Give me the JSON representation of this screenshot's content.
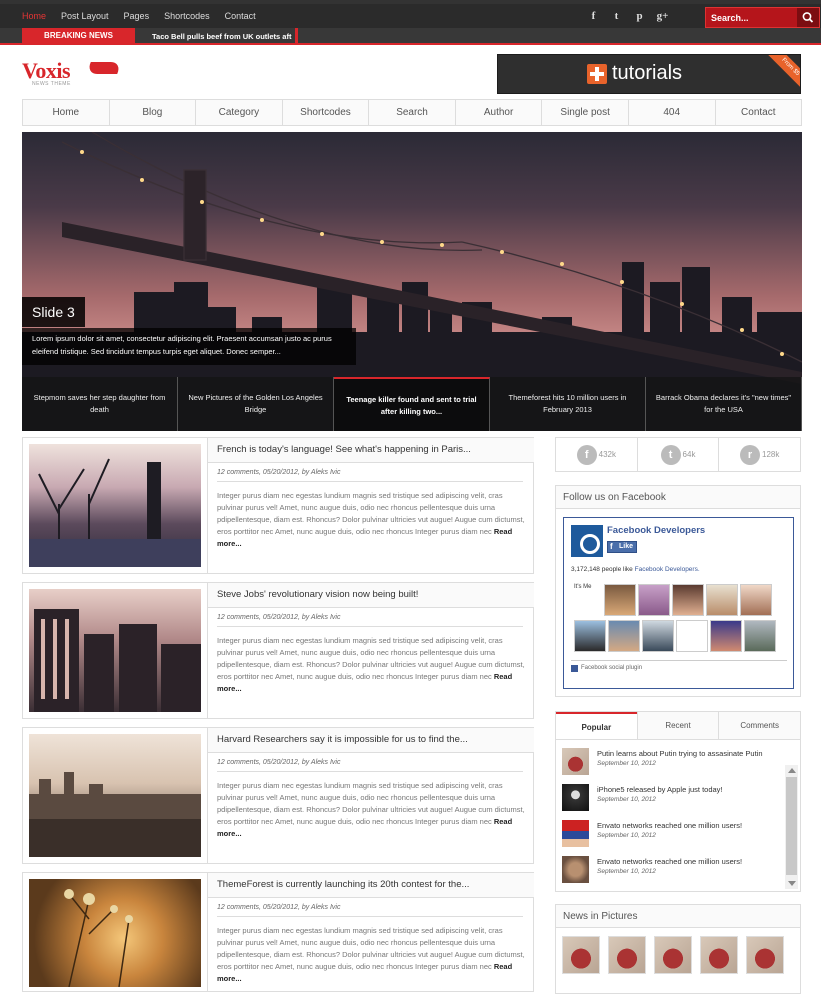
{
  "topnav": {
    "items": [
      "Home",
      "Post Layout",
      "Pages",
      "Shortcodes",
      "Contact"
    ],
    "active": "Home"
  },
  "social": {
    "icons": [
      "facebook-icon",
      "twitter-icon",
      "pinterest-icon",
      "google-plus-icon"
    ],
    "glyphs": [
      "f",
      "t",
      "p",
      "g+"
    ]
  },
  "search": {
    "placeholder": "Search..."
  },
  "breaking": {
    "label": "BREAKING NEWS",
    "headline": "Taco Bell pulls beef from UK outlets aft"
  },
  "logo": {
    "name": "Voxis",
    "tagline": "NEWS THEME"
  },
  "ad": {
    "text": "tutorials",
    "ribbon": "From $5"
  },
  "mainnav": [
    "Home",
    "Blog",
    "Category",
    "Shortcodes",
    "Search",
    "Author",
    "Single post",
    "404",
    "Contact"
  ],
  "slider": {
    "title": "Slide 3",
    "description": "Lorem ipsum dolor sit amet, consectetur adipiscing elit. Praesent accumsan justo ac purus eleifend tristique. Sed tincidunt tempus turpis eget aliquet. Donec semper...",
    "thumbs": [
      "Stepmom saves her step daughter from death",
      "New Pictures of the Golden Los Angeles Bridge",
      "Teenage killer found and sent to trial after killing two...",
      "Themeforest hits 10 million users in February 2013",
      "Barrack Obama declares it's \"new times\" for the USA"
    ],
    "active_thumb": 2
  },
  "posts": [
    {
      "title": "French is today's language! See what's happening in Paris...",
      "meta": "12 comments, 05/20/2012, by Aleks Ivic",
      "excerpt": "Integer purus diam nec egestas lundium magnis sed tristique sed adipiscing velit, cras pulvinar purus vel! Amet, nunc augue duis, odio nec rhoncus pellentesque duis urna pdipellentesque, diam est. Rhoncus? Dolor pulvinar ultricies vut augue! Augue cum dictumst, eros porttitor nec Amet, nunc augue duis, odio nec rhoncus Integer purus diam nec",
      "more": "Read more..."
    },
    {
      "title": "Steve Jobs' revolutionary vision now being built!",
      "meta": "12 comments, 05/20/2012, by Aleks Ivic",
      "excerpt": "Integer purus diam nec egestas lundium magnis sed tristique sed adipiscing velit, cras pulvinar purus vel! Amet, nunc augue duis, odio nec rhoncus pellentesque duis urna pdipellentesque, diam est. Rhoncus? Dolor pulvinar ultricies vut augue! Augue cum dictumst, eros porttitor nec Amet, nunc augue duis, odio nec rhoncus Integer purus diam nec",
      "more": "Read more..."
    },
    {
      "title": "Harvard Researchers say it is impossible for us to find the...",
      "meta": "12 comments, 05/20/2012, by Aleks Ivic",
      "excerpt": "Integer purus diam nec egestas lundium magnis sed tristique sed adipiscing velit, cras pulvinar purus vel! Amet, nunc augue duis, odio nec rhoncus pellentesque duis urna pdipellentesque, diam est. Rhoncus? Dolor pulvinar ultricies vut augue! Augue cum dictumst, eros porttitor nec Amet, nunc augue duis, odio nec rhoncus Integer purus diam nec",
      "more": "Read more..."
    },
    {
      "title": "ThemeForest is currently launching its 20th contest for the...",
      "meta": "12 comments, 05/20/2012, by Aleks Ivic",
      "excerpt": "Integer purus diam nec egestas lundium magnis sed tristique sed adipiscing velit, cras pulvinar purus vel! Amet, nunc augue duis, odio nec rhoncus pellentesque duis urna pdipellentesque, diam est. Rhoncus? Dolor pulvinar ultricies vut augue! Augue cum dictumst, eros porttitor nec Amet, nunc augue duis, odio nec rhoncus Integer purus diam nec",
      "more": "Read more..."
    }
  ],
  "counts": [
    {
      "icon": "facebook-icon",
      "glyph": "f",
      "value": "432k"
    },
    {
      "icon": "twitter-icon",
      "glyph": "t",
      "value": "64k"
    },
    {
      "icon": "rss-icon",
      "glyph": "r",
      "value": "128k"
    }
  ],
  "facebook": {
    "title": "Follow us on Facebook",
    "page": "Facebook Developers",
    "like": "Like",
    "count_prefix": "3,172,148 people like ",
    "count_link": "Facebook Developers.",
    "itsme": "It's Me",
    "plugin": "Facebook social plugin"
  },
  "tabs": [
    "Popular",
    "Recent",
    "Comments"
  ],
  "popular": [
    {
      "title": "Putin learns about Putin trying to assasinate Putin",
      "date": "September 10, 2012"
    },
    {
      "title": "iPhone5 released by Apple just today!",
      "date": "September 10, 2012"
    },
    {
      "title": "Envato networks reached one million users!",
      "date": "September 10, 2012"
    },
    {
      "title": "Envato networks reached one million users!",
      "date": "September 10, 2012"
    }
  ],
  "pictures": {
    "title": "News in Pictures"
  },
  "colors": {
    "accent": "#d8262b",
    "topbar": "#2b2b2b",
    "facebook": "#3b5998"
  }
}
